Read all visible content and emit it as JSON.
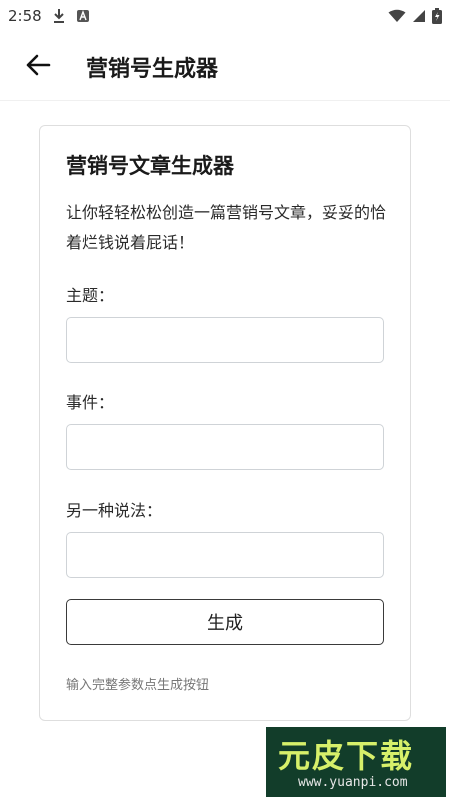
{
  "status_bar": {
    "time": "2:58",
    "icons": [
      "download-icon",
      "app-notification-icon",
      "wifi-icon",
      "signal-icon",
      "battery-charging-icon"
    ]
  },
  "app_bar": {
    "back_icon": "arrow-left-icon",
    "title": "营销号生成器"
  },
  "card": {
    "title": "营销号文章生成器",
    "description": "让你轻轻松松创造一篇营销号文章，妥妥的恰着烂钱说着屁话！",
    "fields": [
      {
        "label": "主题：",
        "value": "",
        "placeholder": ""
      },
      {
        "label": "事件：",
        "value": "",
        "placeholder": ""
      },
      {
        "label": "另一种说法：",
        "value": "",
        "placeholder": ""
      }
    ],
    "generate_label": "生成",
    "hint": "输入完整参数点生成按钮"
  },
  "watermark": {
    "brand": "元皮下载",
    "url": "www.yuanpi.com",
    "bg_color": "#123d2a",
    "accent_color": "#d7f06a"
  }
}
